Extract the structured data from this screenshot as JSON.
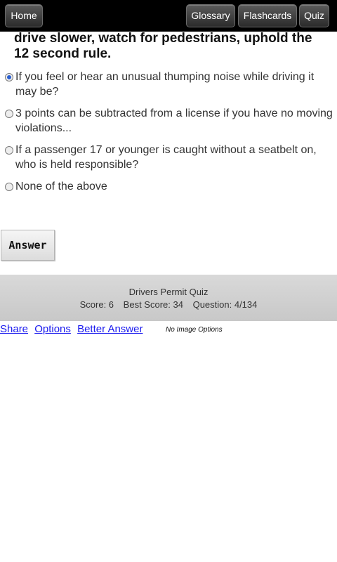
{
  "nav": {
    "home": "Home",
    "glossary": "Glossary",
    "flashcards": "Flashcards",
    "quiz": "Quiz"
  },
  "question": {
    "text": "drive slower, watch for pedestrians, uphold the 12 second rule."
  },
  "options": [
    {
      "label": "If you feel or hear an unusual thumping noise while driving it may be?",
      "selected": true
    },
    {
      "label": "3 points can be subtracted from a license if you have no moving violations...",
      "selected": false
    },
    {
      "label": "If a passenger 17 or younger is caught without a seatbelt on, who is held responsible?",
      "selected": false
    },
    {
      "label": "None of the above",
      "selected": false
    }
  ],
  "answer_button": "Answer",
  "scorebar": {
    "title": "Drivers Permit Quiz",
    "score": "Score: 6",
    "best": "Best Score: 34",
    "question": "Question: 4/134"
  },
  "links": {
    "share": "Share",
    "options": "Options",
    "better_answer": "Better Answer",
    "no_image": "No Image Options"
  }
}
